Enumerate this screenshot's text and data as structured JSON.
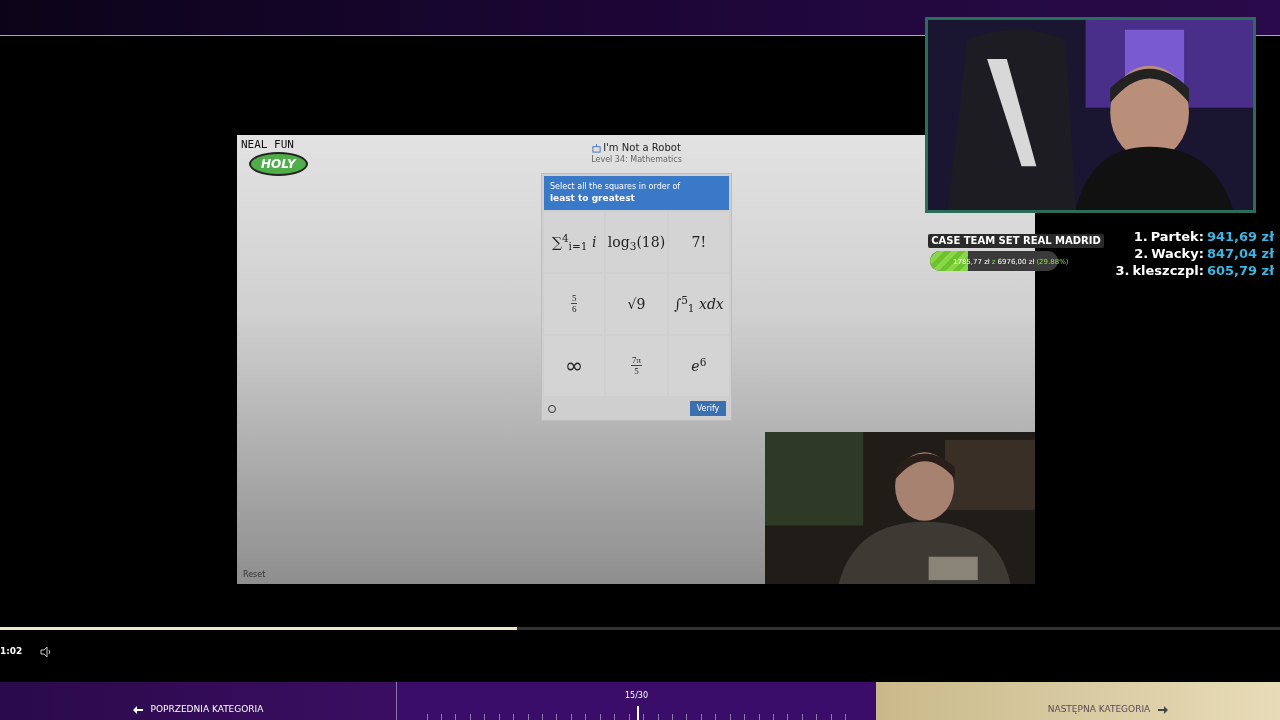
{
  "game": {
    "logo_top": "NEAL FUN",
    "logo_badge": "HOLY",
    "title": "I'm Not a Robot",
    "subtitle": "Level 34: Mathematics",
    "prompt": "Select all the squares in order of",
    "prompt_strong": "least to greatest",
    "tiles": [
      {
        "kind": "text",
        "text": "∑$^{4}$$_{i=1}$ *i*",
        "selected": false
      },
      {
        "kind": "text",
        "text": "log$_{3}$(18)",
        "selected": false
      },
      {
        "kind": "text",
        "text": "7!",
        "selected": false
      },
      {
        "kind": "fraction",
        "numerator": "5",
        "denominator": "6",
        "selected": false
      },
      {
        "kind": "text",
        "text": "√9",
        "selected": false
      },
      {
        "kind": "text",
        "text": "∫$^{5}$$_{1}$ *xdx*",
        "selected": false
      },
      {
        "kind": "symbol",
        "text": "∞",
        "selected": false
      },
      {
        "kind": "fraction",
        "numerator": "7π",
        "denominator": "5",
        "selected": false
      },
      {
        "kind": "text",
        "text": "*e*$^{6}$",
        "selected": false
      }
    ],
    "verify": "Verify",
    "reset": "Reset"
  },
  "goal": {
    "title": "CASE TEAM SET REAL MADRID",
    "level": 0.2988,
    "current": "1785,77 zł",
    "separator": "z",
    "target": "6976,00 zł",
    "percent": "(29.88%)"
  },
  "leaderboard": [
    {
      "rank": "1.",
      "name": "Partek:",
      "amount": "941,69 zł"
    },
    {
      "rank": "2.",
      "name": "Wacky:",
      "amount": "847,04 zł"
    },
    {
      "rank": "3.",
      "name": "kleszczpl:",
      "amount": "605,79 zł"
    }
  ],
  "player": {
    "level": 0.404,
    "time": "1:02"
  },
  "nav": {
    "prev": "POPRZEDNIA KATEGORIA",
    "counter": "15/30",
    "level": 0.5,
    "next": "NASTĘPNA KATEGORIA"
  }
}
